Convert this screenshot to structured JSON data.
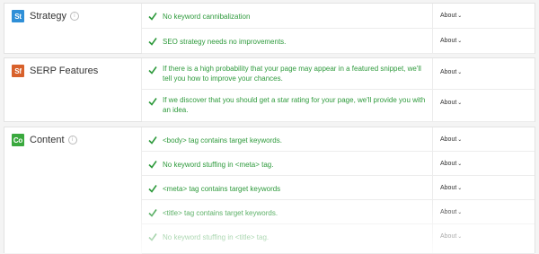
{
  "sections": [
    {
      "id": "strategy",
      "badge": "St",
      "badge_color": "#2f8fd7",
      "title": "Strategy",
      "rows": [
        {
          "text": "No keyword cannibalization",
          "action": "About"
        },
        {
          "text": "SEO strategy needs no improvements.",
          "action": "About"
        }
      ]
    },
    {
      "id": "serp",
      "badge": "Sf",
      "badge_color": "#d8612b",
      "title": "SERP Features",
      "rows": [
        {
          "text": "If there is a high probability that your page may appear in a featured snippet, we'll tell you how to improve your chances.",
          "action": "About"
        },
        {
          "text": "If we discover that you should get a star rating for your page, we'll provide you with an idea.",
          "action": "About"
        }
      ]
    },
    {
      "id": "content",
      "badge": "Co",
      "badge_color": "#3aa93e",
      "title": "Content",
      "rows": [
        {
          "text": "<body> tag contains target keywords.",
          "action": "About"
        },
        {
          "text": "No keyword stuffing in <meta> tag.",
          "action": "About"
        },
        {
          "text": "<meta> tag contains target keywords",
          "action": "About"
        },
        {
          "text": "<title> tag contains target keywords.",
          "action": "About"
        },
        {
          "text": "No keyword stuffing in <title> tag.",
          "action": "About"
        }
      ]
    }
  ],
  "icons": {
    "info": "info-icon",
    "check": "check-icon",
    "chevron": "chevron-down-icon"
  }
}
